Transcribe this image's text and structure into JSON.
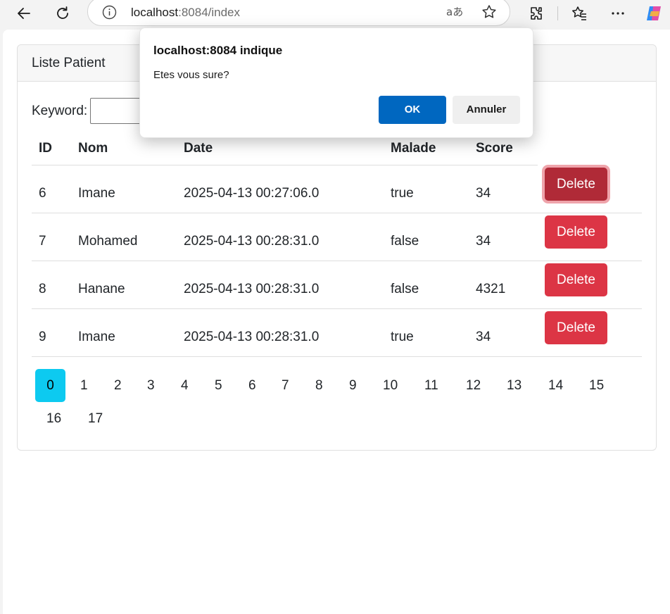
{
  "browser": {
    "url_host": "localhost",
    "url_rest": ":8084/index"
  },
  "card": {
    "header": "Liste Patient",
    "keyword_label": "Keyword:",
    "keyword_value": ""
  },
  "table": {
    "headers": [
      "ID",
      "Nom",
      "Date",
      "Malade",
      "Score"
    ],
    "rows": [
      {
        "id": "6",
        "nom": "Imane",
        "date": "2025-04-13 00:27:06.0",
        "malade": "true",
        "score": "34",
        "action": "Delete"
      },
      {
        "id": "7",
        "nom": "Mohamed",
        "date": "2025-04-13 00:28:31.0",
        "malade": "false",
        "score": "34",
        "action": "Delete"
      },
      {
        "id": "8",
        "nom": "Hanane",
        "date": "2025-04-13 00:28:31.0",
        "malade": "false",
        "score": "4321",
        "action": "Delete"
      },
      {
        "id": "9",
        "nom": "Imane",
        "date": "2025-04-13 00:28:31.0",
        "malade": "true",
        "score": "34",
        "action": "Delete"
      }
    ]
  },
  "pagination": {
    "pages": [
      "0",
      "1",
      "2",
      "3",
      "4",
      "5",
      "6",
      "7",
      "8",
      "9",
      "10",
      "11",
      "12",
      "13",
      "14",
      "15",
      "16",
      "17"
    ],
    "active": "0"
  },
  "dialog": {
    "title": "localhost:8084 indique",
    "message": "Etes vous sure?",
    "ok_label": "OK",
    "cancel_label": "Annuler"
  },
  "colors": {
    "danger": "#dc3545",
    "info": "#0dcaf0",
    "dialog_ok": "#0067c0"
  }
}
